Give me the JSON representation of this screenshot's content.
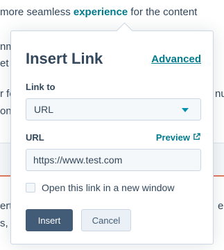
{
  "background": {
    "line1_prefix": "more seamless ",
    "line1_keyword": "experience",
    "line1_suffix": " for the content",
    "frag_a": "nm",
    "frag_b": "et",
    "frag_c": "r fo",
    "frag_c_right": "nu",
    "frag_d": "on",
    "frag_e": "ert",
    "frag_e_right": "e",
    "frag_f": "s, c"
  },
  "dialog": {
    "title": "Insert Link",
    "advanced_label": "Advanced",
    "link_to_label": "Link to",
    "link_to_value": "URL",
    "url_label": "URL",
    "preview_label": "Preview",
    "url_value": "https://www.test.com",
    "new_window_label": "Open this link in a new window",
    "insert_label": "Insert",
    "cancel_label": "Cancel"
  },
  "colors": {
    "accent": "#007a8c",
    "primary_button": "#425b76",
    "text": "#33475b",
    "border": "#cbd6e2"
  },
  "icons": {
    "select_caret": "chevron-down-icon",
    "preview": "external-link-icon"
  }
}
